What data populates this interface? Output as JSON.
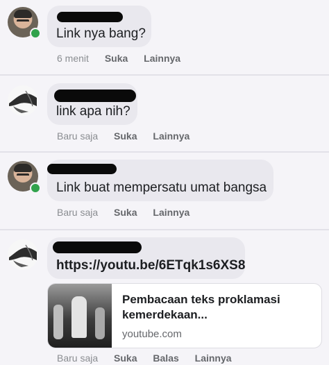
{
  "comments": [
    {
      "message": "Link nya bang?",
      "time": "6 menit",
      "actions": [
        "Suka",
        "Lainnya"
      ],
      "avatar_icon": "person-photo-icon",
      "online": true
    },
    {
      "message": "link apa nih?",
      "time": "Baru saja",
      "actions": [
        "Suka",
        "Lainnya"
      ],
      "avatar_icon": "abstract-art-icon",
      "online": false
    },
    {
      "message": "Link buat mempersatu umat bangsa",
      "time": "Baru saja",
      "actions": [
        "Suka",
        "Lainnya"
      ],
      "avatar_icon": "person-photo-icon",
      "online": true
    },
    {
      "message": "https://youtu.be/6ETqk1s6XS8",
      "time": "Baru saja",
      "actions": [
        "Suka",
        "Balas",
        "Lainnya"
      ],
      "avatar_icon": "abstract-art-icon",
      "online": false,
      "link_preview": {
        "title": "Pembacaan teks proklamasi kemerdekaan...",
        "domain": "youtube.com",
        "thumbnail_icon": "video-thumbnail-icon"
      }
    }
  ],
  "colors": {
    "background": "#f5f4f8",
    "bubble": "#e9e8ee",
    "online": "#31a24c",
    "action_text": "#65676b",
    "time_text": "#8a8d91",
    "redaction": "#0a0a0a"
  }
}
